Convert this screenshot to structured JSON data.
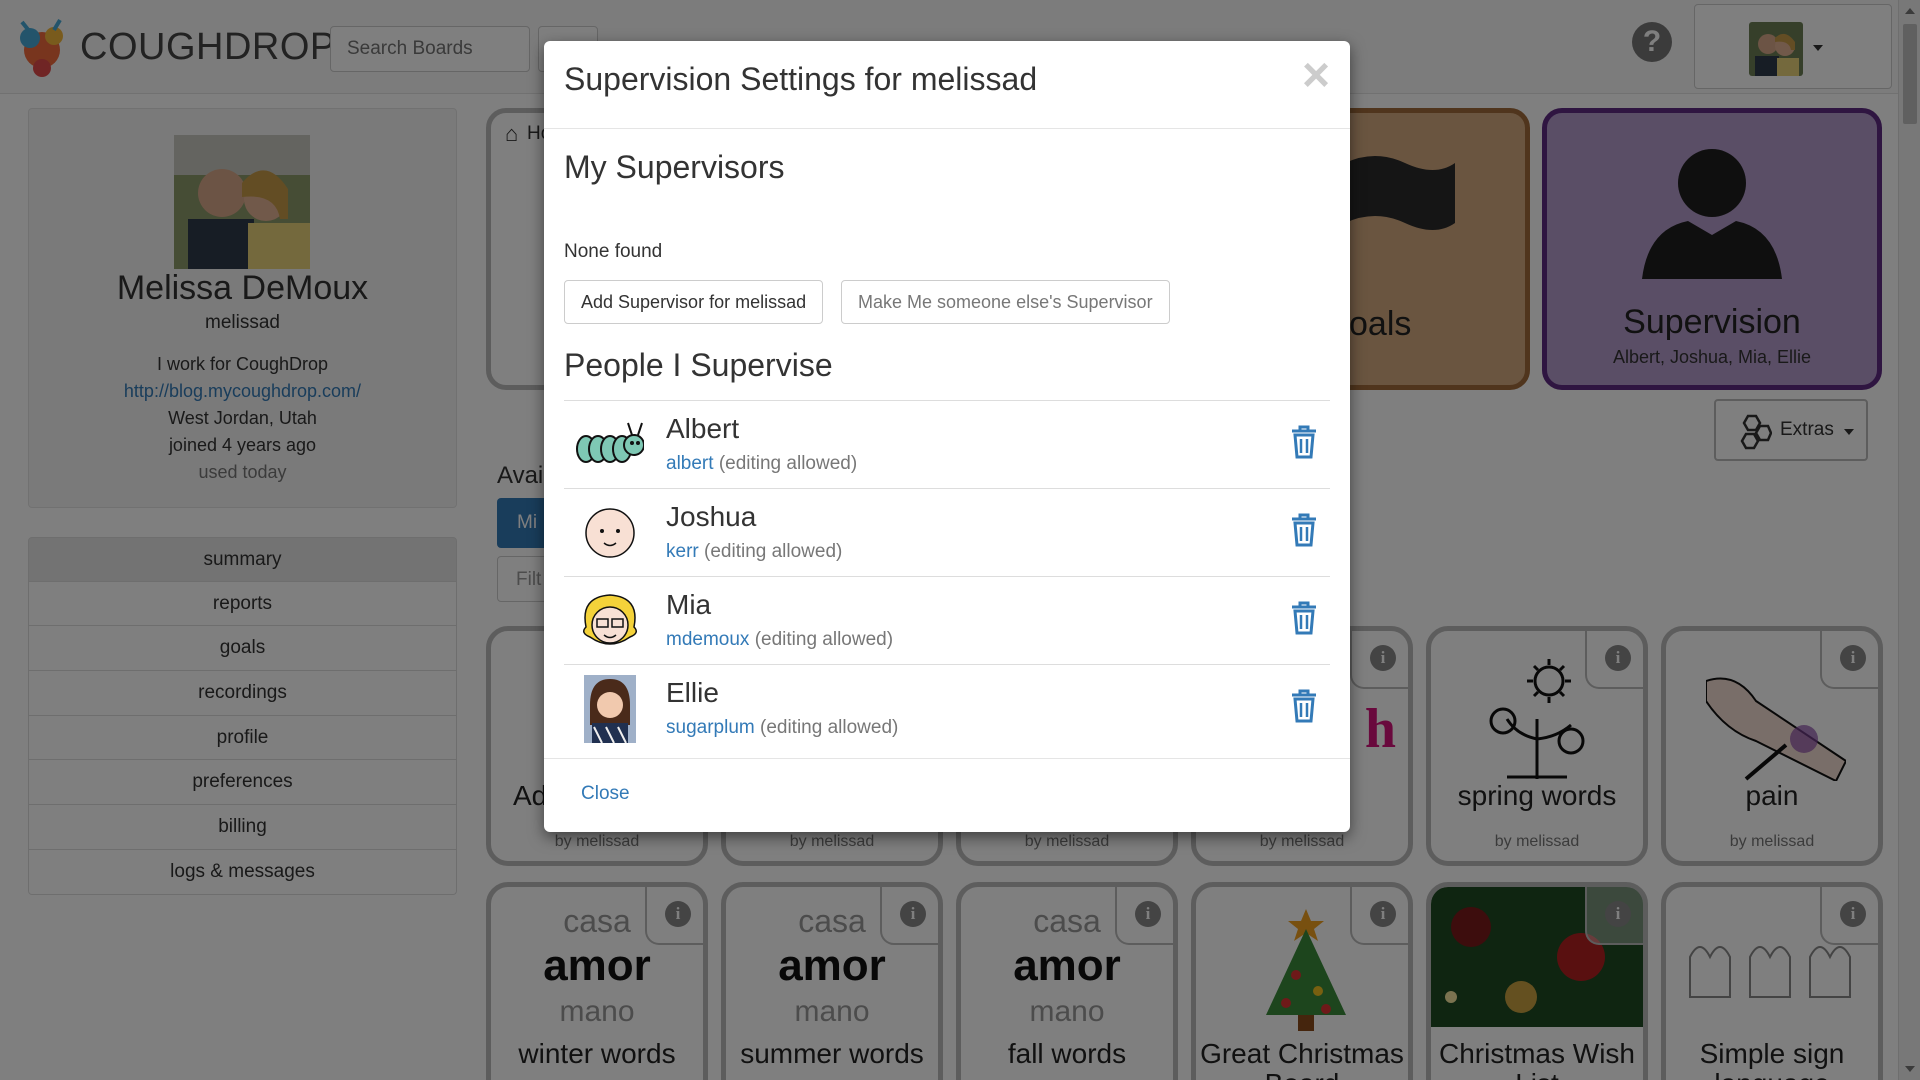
{
  "app": {
    "brand": "COUGHDROP",
    "search_placeholder": "Search Boards",
    "help_icon": "question-circle-icon"
  },
  "profile": {
    "name": "Melissa DeMoux",
    "username": "melissad",
    "bio": "I work for CoughDrop",
    "link": "http://blog.mycoughdrop.com/",
    "location": "West Jordan, Utah",
    "joined": "joined 4 years ago",
    "usage": "used today"
  },
  "sidebar": {
    "items": [
      {
        "label": "summary"
      },
      {
        "label": "reports"
      },
      {
        "label": "goals"
      },
      {
        "label": "recordings"
      },
      {
        "label": "profile"
      },
      {
        "label": "preferences"
      },
      {
        "label": "billing"
      },
      {
        "label": "logs & messages"
      }
    ]
  },
  "main": {
    "home_fragment": "Ho",
    "goals_fragment": "oals",
    "supervision_tile": {
      "label": "Supervision",
      "sub": "Albert, Joshua, Mia, Ellie",
      "color": "#b49ccc",
      "border": "#5e2a83"
    },
    "goals_tile_color": "#d4aa80",
    "goals_tile_border": "#a06a3a",
    "extras_label": "Extras",
    "available_fragment": "Avai",
    "min_fragment": "Mi",
    "filter_fragment": "Filt",
    "boards_row1": [
      {
        "name": "Ad",
        "by": "by melissad"
      },
      {
        "name": "",
        "by": "by melissad"
      },
      {
        "name": "",
        "by": "by melissad"
      },
      {
        "name": "",
        "by": "by melissad",
        "art_fragment": "h"
      },
      {
        "name": "spring words",
        "by": "by melissad"
      },
      {
        "name": "pain",
        "by": "by melissad"
      }
    ],
    "boards_row2": [
      {
        "w1": "casa",
        "w2": "amor",
        "w3": "mano",
        "name": "winter words"
      },
      {
        "w1": "casa",
        "w2": "amor",
        "w3": "mano",
        "name": "summer words"
      },
      {
        "w1": "casa",
        "w2": "amor",
        "w3": "mano",
        "name": "fall words"
      },
      {
        "name": "Great Christmas Board"
      },
      {
        "name": "Christmas Wish List"
      },
      {
        "name": "Simple sign language"
      }
    ]
  },
  "modal": {
    "title": "Supervision Settings for melissad",
    "close_symbol": "×",
    "my_supervisors_heading": "My Supervisors",
    "none_found": "None found",
    "add_supervisor_label": "Add Supervisor for melissad",
    "make_me_label": "Make Me someone else's Supervisor",
    "people_heading": "People I Supervise",
    "supervisees": [
      {
        "name": "Albert",
        "username": "albert",
        "permission": "(editing allowed)",
        "avatar_icon": "caterpillar-icon"
      },
      {
        "name": "Joshua",
        "username": "kerr",
        "permission": "(editing allowed)",
        "avatar_icon": "baby-face-icon"
      },
      {
        "name": "Mia",
        "username": "mdemoux",
        "permission": "(editing allowed)",
        "avatar_icon": "girl-glasses-icon"
      },
      {
        "name": "Ellie",
        "username": "sugarplum",
        "permission": "(editing allowed)",
        "avatar_icon": "photo-avatar"
      }
    ],
    "footer_close": "Close"
  }
}
